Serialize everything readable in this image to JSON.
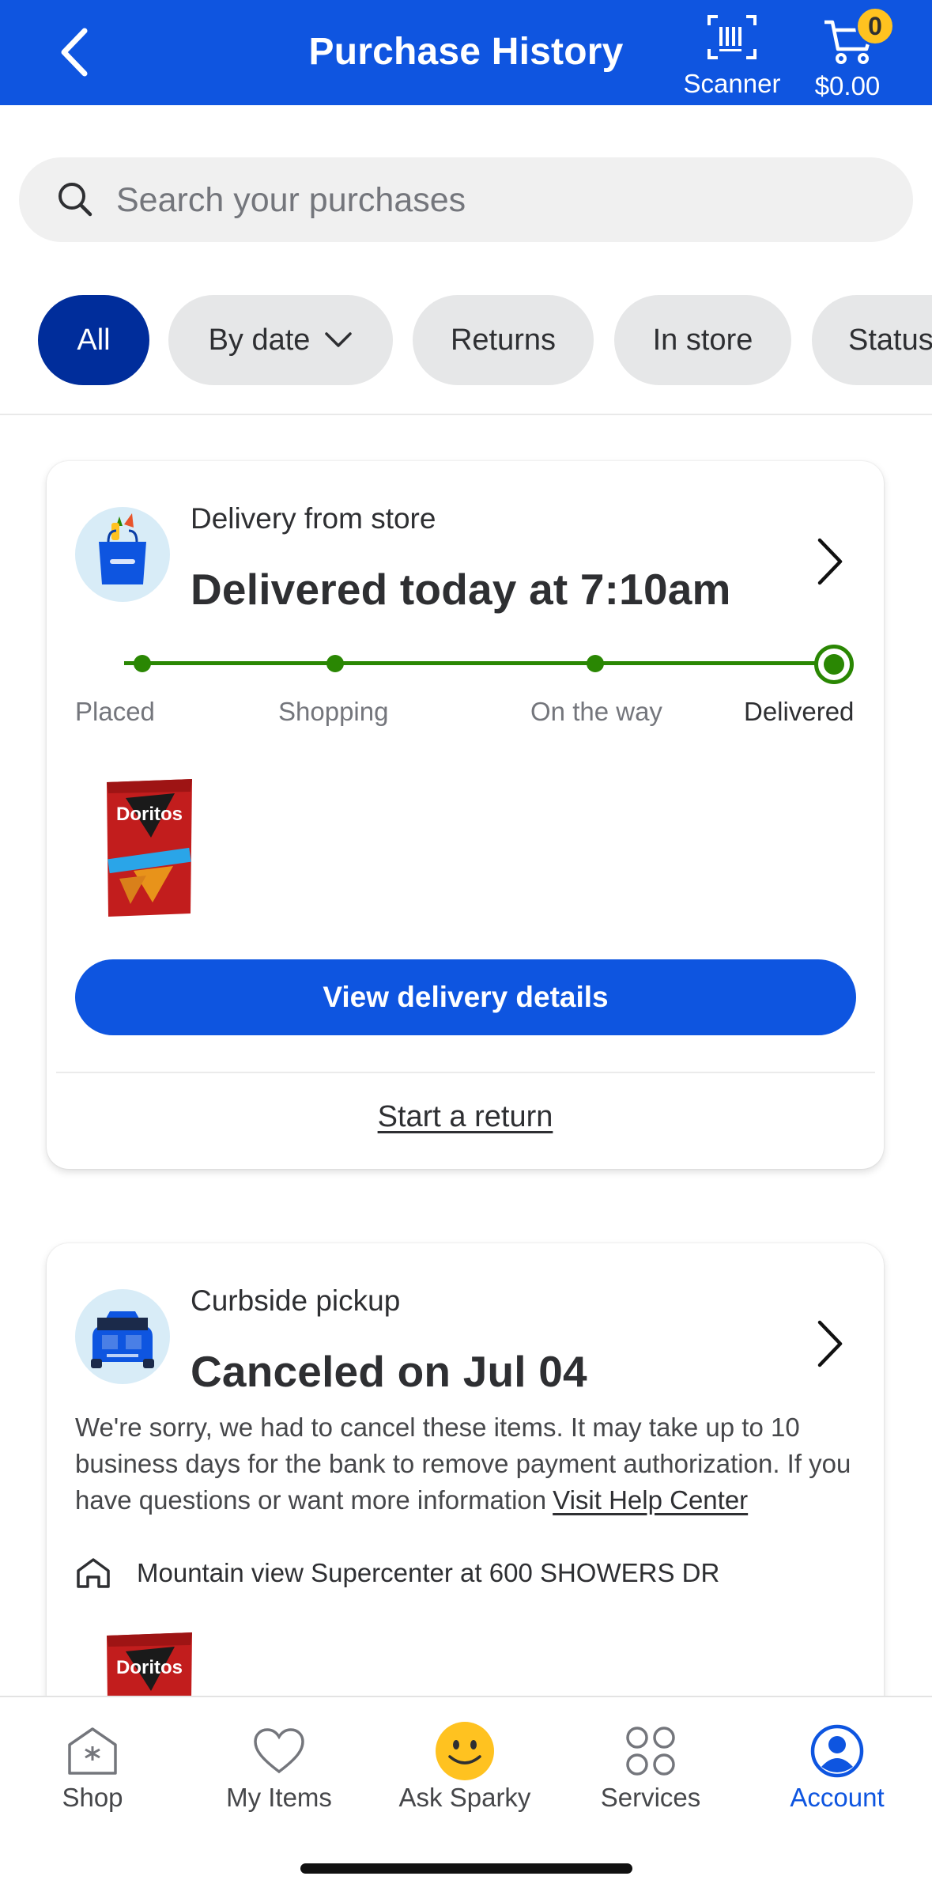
{
  "header": {
    "title": "Purchase History",
    "scanner_label": "Scanner",
    "cart_total": "$0.00",
    "cart_count": "0",
    "brand_color": "#0f55e0"
  },
  "search": {
    "placeholder": "Search your purchases"
  },
  "filters": [
    {
      "label": "All",
      "active": true
    },
    {
      "label": "By date",
      "active": false
    },
    {
      "label": "Returns",
      "active": false
    },
    {
      "label": "In store",
      "active": false
    },
    {
      "label": "Status",
      "active": false
    }
  ],
  "orders": [
    {
      "type": "Delivery from store",
      "status": "Delivered today at 7:10am",
      "steps": [
        "Placed",
        "Shopping",
        "On the way",
        "Delivered"
      ],
      "current_step": 4,
      "primary_action": "View delivery details",
      "secondary_action": "Start a return"
    },
    {
      "type": "Curbside pickup",
      "status": "Canceled on Jul 04",
      "message": "We're sorry, we had to cancel these items. It may take up to 10 business days for the bank to remove payment authorization. If you have questions or want more information",
      "help_link": "Visit Help Center",
      "store": "Mountain view Supercenter at 600 SHOWERS DR"
    }
  ],
  "bottom_nav": [
    {
      "label": "Shop",
      "icon": "shop-icon",
      "active": false
    },
    {
      "label": "My Items",
      "icon": "heart-icon",
      "active": false
    },
    {
      "label": "Ask Sparky",
      "icon": "sparky-icon",
      "active": false
    },
    {
      "label": "Services",
      "icon": "services-icon",
      "active": false
    },
    {
      "label": "Account",
      "icon": "account-icon",
      "active": true
    }
  ],
  "colors": {
    "accent": "#0e55e0",
    "chip_active": "#002d9b",
    "success": "#2a8703",
    "spark_yellow": "#ffc220"
  }
}
